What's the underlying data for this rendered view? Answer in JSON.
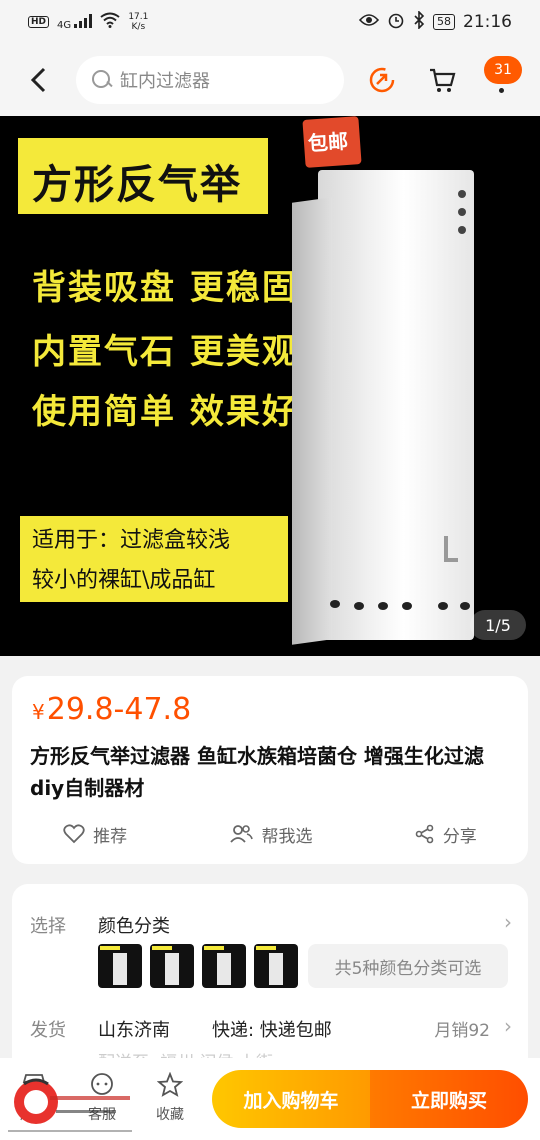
{
  "status_bar": {
    "left_badge": "HD",
    "signal": "4G",
    "net_speed_value": "17.1",
    "net_speed_unit": "K/s",
    "battery": "58",
    "time": "21:16"
  },
  "header": {
    "search_placeholder": "缸内过滤器",
    "message_count": "31"
  },
  "product_image": {
    "title": "方形反气举",
    "stamp": "包邮",
    "features": [
      "背装吸盘  更稳固",
      "内置气石  更美观",
      "使用简单  效果好"
    ],
    "note_lines": [
      "适用于：过滤盒较浅",
      "较小的裸缸\\成品缸"
    ],
    "pager": "1/5"
  },
  "price_card": {
    "currency": "¥",
    "price": "29.8-47.8",
    "title": "方形反气举过滤器 鱼缸水族箱培菌仓 增强生化过滤 diy自制器材",
    "actions": [
      {
        "label": "推荐",
        "icon": "heart-icon"
      },
      {
        "label": "帮我选",
        "icon": "people-icon"
      },
      {
        "label": "分享",
        "icon": "share-icon"
      }
    ]
  },
  "options": {
    "select_label": "选择",
    "select_value": "颜色分类",
    "variants_text": "共5种颜色分类可选",
    "ship_label": "发货",
    "ship_origin": "山东济南",
    "ship_method": "快递: 快递包邮",
    "monthly_sales": "月销92",
    "delivery_partial": "配送至: 福州 闽侯 上街"
  },
  "bottom_bar": {
    "shop": "店铺",
    "service": "客服",
    "favorite": "收藏",
    "add_to_cart": "加入购物车",
    "buy_now": "立即购买"
  },
  "colors": {
    "accent": "#ff5000",
    "banner_yellow": "#f4e93a"
  }
}
